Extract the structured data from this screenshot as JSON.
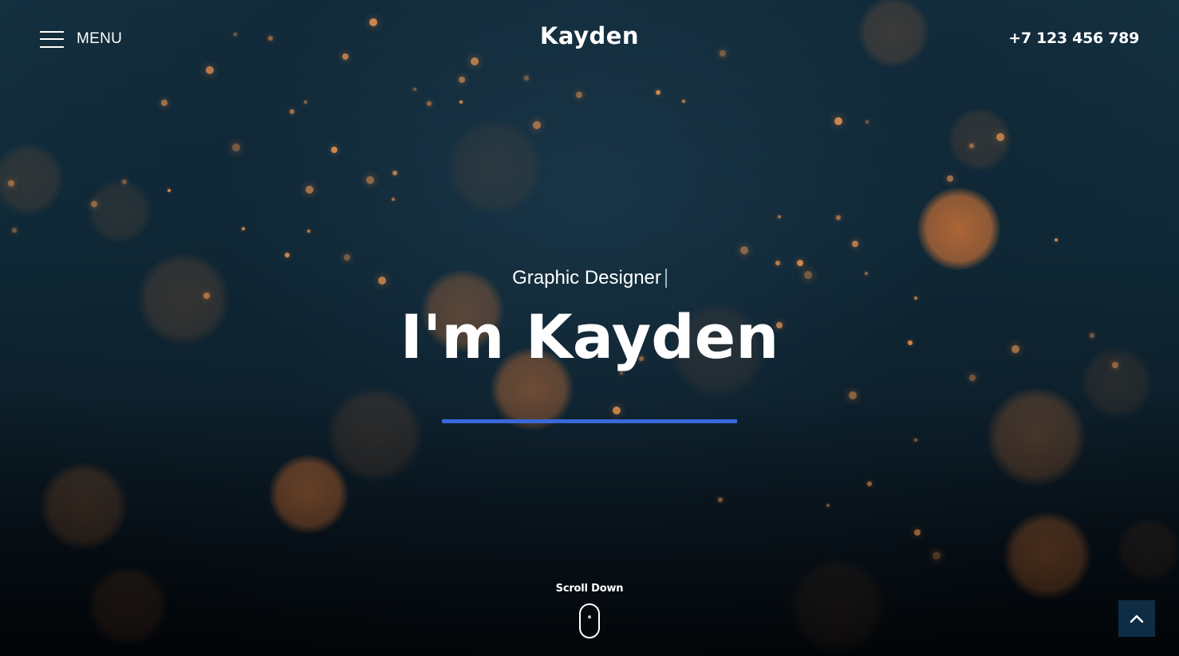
{
  "header": {
    "menu_label": "MENU",
    "brand": "Kayden",
    "phone": "+7 123 456 789"
  },
  "hero": {
    "subtitle": "Graphic Designer",
    "title": "I'm Kayden"
  },
  "scroll": {
    "label": "Scroll Down"
  },
  "icons": {
    "menu": "hamburger-icon",
    "scroll": "mouse-icon",
    "back_to_top": "chevron-up-icon"
  },
  "colors": {
    "accent": "#3a68d8",
    "text": "#ffffff",
    "back_to_top_bg": "#0f2c45",
    "bokeh": "#e07a36"
  }
}
